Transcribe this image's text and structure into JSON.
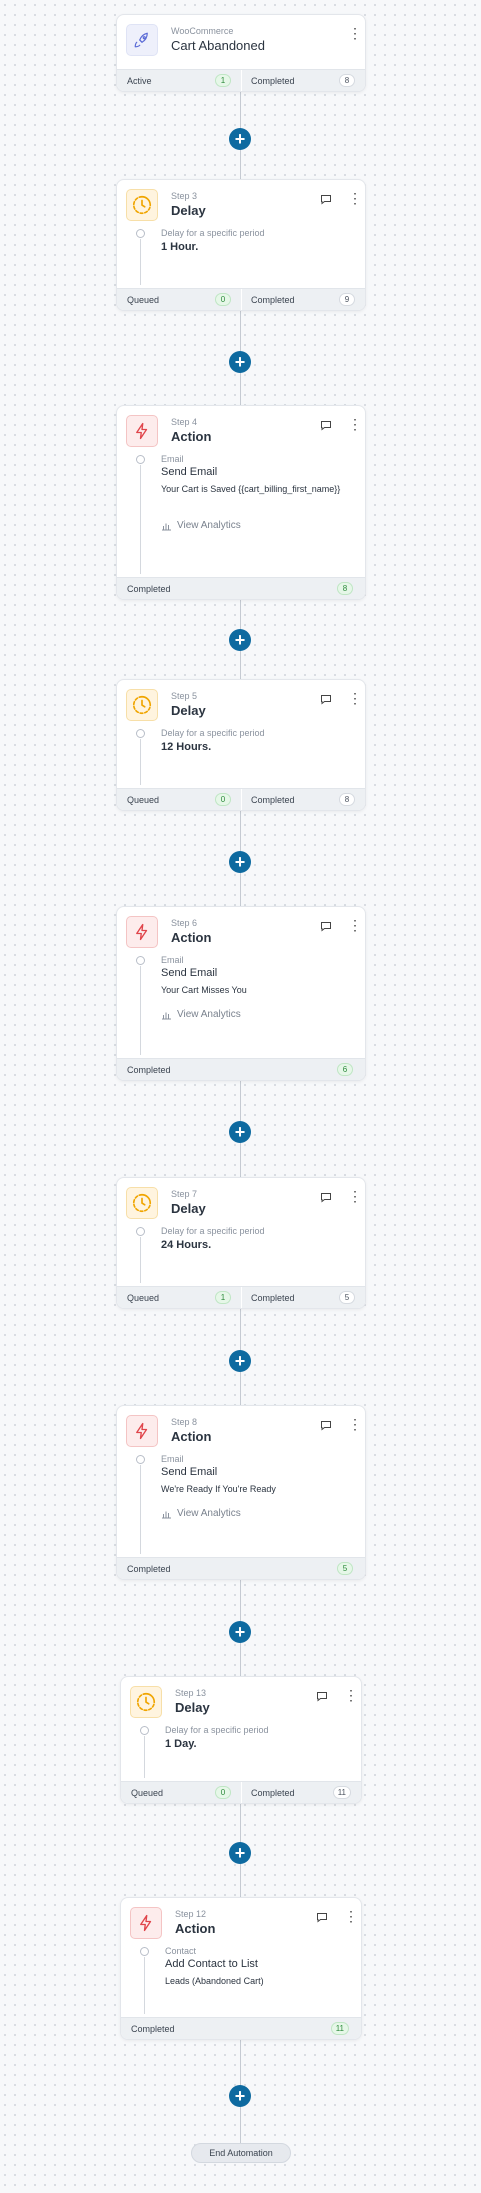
{
  "colors": {
    "plus_button": "#0e6aa0",
    "trigger_icon": "#5b6bd6",
    "delay_icon": "#f0a500",
    "action_icon": "#e0444a",
    "completed_badge": "#2c8a3b"
  },
  "trigger": {
    "label": "WooCommerce",
    "title": "Cart Abandoned",
    "icon": "rocket-icon",
    "stats": {
      "left_label": "Active",
      "left_count": "1",
      "right_label": "Completed",
      "right_count": "8"
    }
  },
  "steps": [
    {
      "label": "Step 3",
      "title": "Delay",
      "type": "delay",
      "sub_label": "Delay for a specific period",
      "value": "1 Hour.",
      "stats": {
        "left_label": "Queued",
        "left_count": "0",
        "right_label": "Completed",
        "right_count": "9"
      }
    },
    {
      "label": "Step 4",
      "title": "Action",
      "type": "action",
      "sub_label": "Email",
      "value": "Send Email",
      "desc": "Your Cart is Saved {{cart_billing_first_name}}",
      "analytics": "View Analytics",
      "stats": {
        "left_label": "Completed",
        "left_count": "8"
      }
    },
    {
      "label": "Step 5",
      "title": "Delay",
      "type": "delay",
      "sub_label": "Delay for a specific period",
      "value": "12 Hours.",
      "stats": {
        "left_label": "Queued",
        "left_count": "0",
        "right_label": "Completed",
        "right_count": "8"
      }
    },
    {
      "label": "Step 6",
      "title": "Action",
      "type": "action",
      "sub_label": "Email",
      "value": "Send Email",
      "desc": "Your Cart Misses You",
      "analytics": "View Analytics",
      "stats": {
        "left_label": "Completed",
        "left_count": "6"
      }
    },
    {
      "label": "Step 7",
      "title": "Delay",
      "type": "delay",
      "sub_label": "Delay for a specific period",
      "value": "24 Hours.",
      "stats": {
        "left_label": "Queued",
        "left_count": "1",
        "right_label": "Completed",
        "right_count": "5"
      }
    },
    {
      "label": "Step 8",
      "title": "Action",
      "type": "action",
      "sub_label": "Email",
      "value": "Send Email",
      "desc": "We're Ready If You're Ready",
      "analytics": "View Analytics",
      "stats": {
        "left_label": "Completed",
        "left_count": "5"
      }
    },
    {
      "label": "Step 13",
      "title": "Delay",
      "type": "delay",
      "sub_label": "Delay for a specific period",
      "value": "1 Day.",
      "stats": {
        "left_label": "Queued",
        "left_count": "0",
        "right_label": "Completed",
        "right_count": "11"
      }
    },
    {
      "label": "Step 12",
      "title": "Action",
      "type": "action",
      "sub_label": "Contact",
      "value": "Add Contact to List",
      "desc": "Leads (Abandoned Cart)",
      "stats": {
        "left_label": "Completed",
        "left_count": "11"
      }
    }
  ],
  "add_step_symbol": "+",
  "end_label": "End Automation"
}
